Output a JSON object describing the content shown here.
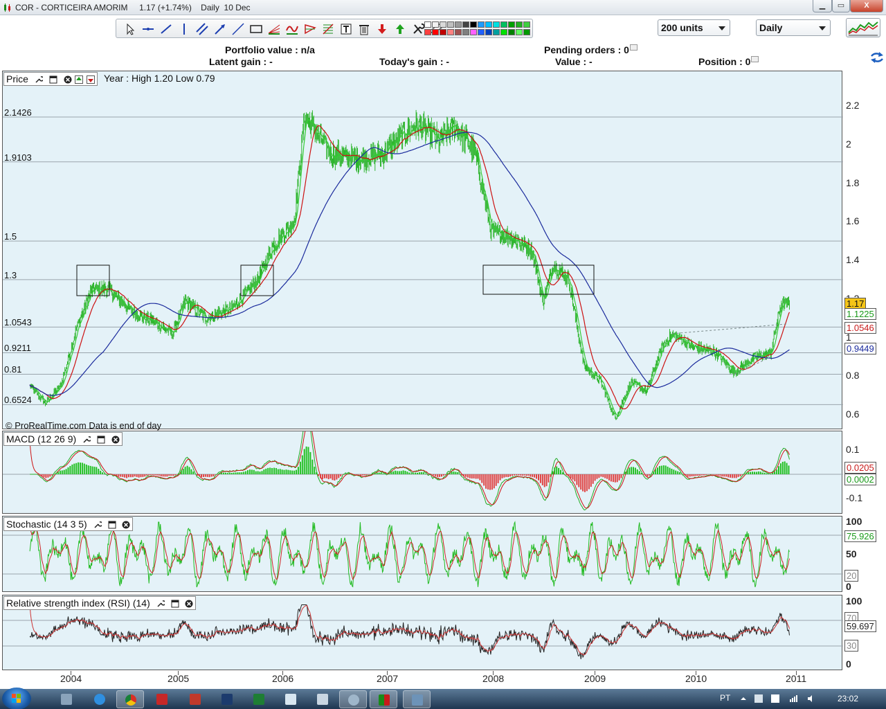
{
  "window": {
    "title": "COR - CORTICEIRA AMORIM     1.17 (+1.74%)    Daily  10 Dec",
    "btn_min": "▁",
    "btn_max": "▭",
    "btn_close": "X"
  },
  "toolbar": {
    "units_value": "200 units",
    "period_value": "Daily",
    "tools": [
      "cursor-icon",
      "horizontal-line-icon",
      "trend-line-icon",
      "vertical-line-icon",
      "parallel-lines-icon",
      "arrow-line-icon",
      "ray-line-icon",
      "rectangle-icon",
      "fibonacci-fan-icon",
      "wave-icon",
      "triangle-icon",
      "fibonacci-retracement-icon",
      "text-icon",
      "trash-icon",
      "sell-arrow-icon",
      "buy-arrow-icon",
      "tools-icon",
      "ruler-icon"
    ]
  },
  "portfolio": {
    "portfolio_value": "Portfolio value : n/a",
    "latent_gain": "Latent gain : -",
    "todays_gain": "Today's gain : -",
    "pending_orders": "Pending orders : 0",
    "value": "Value : -",
    "position": "Position : 0"
  },
  "price_panel": {
    "label": "Price",
    "year_info": "Year : High 1.20 Low 0.79",
    "footer": "© ProRealTime.com Data is end of day",
    "levels": [
      "2.1426",
      "1.9103",
      "1.5",
      "1.3",
      "1.0543",
      "0.9211",
      "0.81",
      "0.6524"
    ],
    "axis_ticks": [
      "2.2",
      "2",
      "1.8",
      "1.6",
      "1.4",
      "1.2",
      "1",
      "0.8",
      "0.6"
    ],
    "tag_last": "1.17",
    "tag_ma_fast": "1.1225",
    "tag_ma_mid": "1.0546",
    "tag_ma_slow": "0.9449"
  },
  "macd_panel": {
    "label": "MACD (12 26 9)",
    "axis_ticks": [
      "0.1",
      "0",
      "-0.1"
    ],
    "tag_signal": "0.0205",
    "tag_hist": "0.0002"
  },
  "stoch_panel": {
    "label": "Stochastic (14 3 5)",
    "axis_ticks": [
      "100",
      "50",
      "0"
    ],
    "tag_k": "75.926",
    "tag_level_low": "20"
  },
  "rsi_panel": {
    "label": "Relative strength index (RSI) (14)",
    "axis_ticks": [
      "100",
      "0"
    ],
    "tag_rsi": "59.697",
    "tag_level_high": "70",
    "tag_level_low": "30"
  },
  "x_axis": [
    "2004",
    "2005",
    "2006",
    "2007",
    "2008",
    "2009",
    "2010",
    "2011"
  ],
  "colors": {
    "price_green": "#2fb52f",
    "ma_red": "#cc1111",
    "ma_blue": "#1a2a9c",
    "panel_bg": "#e4f2f8",
    "last_tag": "#f5c518"
  },
  "taskbar": {
    "lang": "PT",
    "clock": "23:02"
  }
}
